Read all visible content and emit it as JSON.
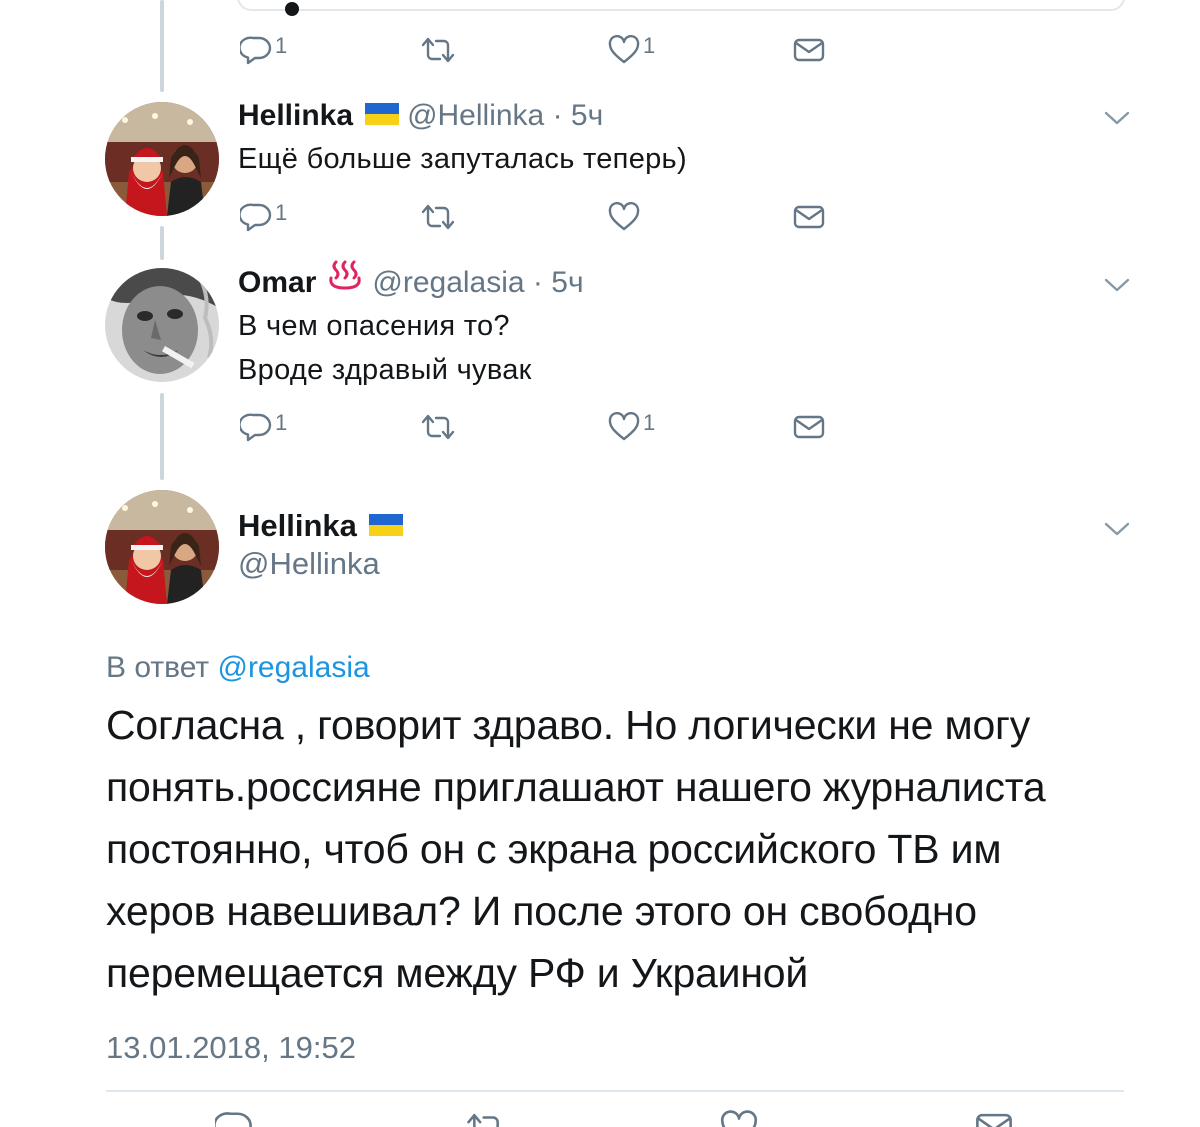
{
  "tweets": [
    {
      "actions": {
        "reply_count": "1",
        "retweet_count": "",
        "like_count": "1"
      }
    },
    {
      "author": "Hellinka",
      "handle": "@Hellinka",
      "separator": "·",
      "time": "5ч",
      "lines": [
        "Ещё больше запуталась теперь)"
      ],
      "actions": {
        "reply_count": "1",
        "retweet_count": "",
        "like_count": ""
      }
    },
    {
      "author": "Omar",
      "handle": "@regalasia",
      "separator": "·",
      "time": "5ч",
      "lines": [
        "В чем опасения то?",
        "Вроде здравый чувак"
      ],
      "actions": {
        "reply_count": "1",
        "retweet_count": "",
        "like_count": "1"
      }
    }
  ],
  "main_tweet": {
    "author": "Hellinka",
    "handle": "@Hellinka",
    "reply_prefix": "В ответ",
    "reply_to": "@regalasia",
    "lines": [
      "Согласна , говорит здраво. Но логически не могу",
      "понять.россияне приглашают нашего журналиста",
      "постоянно, чтоб он с экрана российского ТВ им",
      "херов навешивал? И после этого он свободно",
      "перемещается между РФ и Украиной"
    ],
    "timestamp": "13.01.2018, 19:52"
  },
  "icons": {
    "reply": "reply-icon",
    "retweet": "retweet-icon",
    "like": "heart-icon",
    "dm": "envelope-icon",
    "menu": "chevron-down-icon",
    "flag": "ukraine-flag-icon",
    "hotsprings": "hot-springs-icon"
  },
  "colors": {
    "text": "#14171a",
    "secondary": "#657786",
    "link": "#1b95e0",
    "thread_line": "#ccd6dd",
    "flag_blue": "#1f66d1",
    "flag_yellow": "#f7d117",
    "hotsprings_red": "#e0245e"
  }
}
